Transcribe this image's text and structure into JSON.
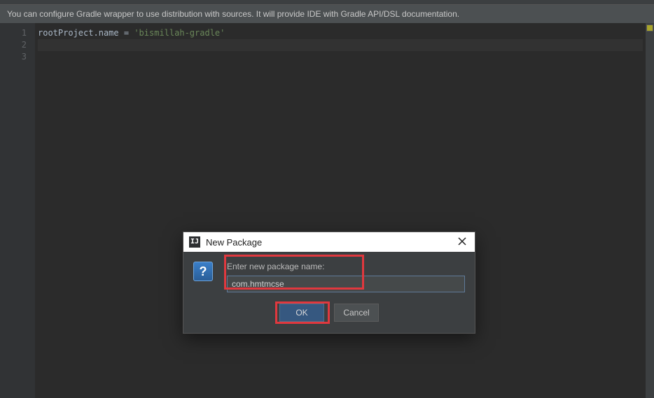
{
  "top_notification": "You can configure Gradle wrapper to use distribution with sources. It will provide IDE with Gradle API/DSL documentation.",
  "gutter": {
    "l1": "1",
    "l2": "2",
    "l3": "3"
  },
  "code": {
    "ident": "rootProject",
    "dot": ".",
    "prop": "name",
    "sp1": " ",
    "eq": "=",
    "sp2": " ",
    "str": "'bismillah-gradle'"
  },
  "dialog": {
    "title": "New Package",
    "icon_glyph": "IJ",
    "q_glyph": "?",
    "label": "Enter new package name:",
    "input_value": "com.hmtmcse",
    "ok": "OK",
    "cancel": "Cancel"
  }
}
